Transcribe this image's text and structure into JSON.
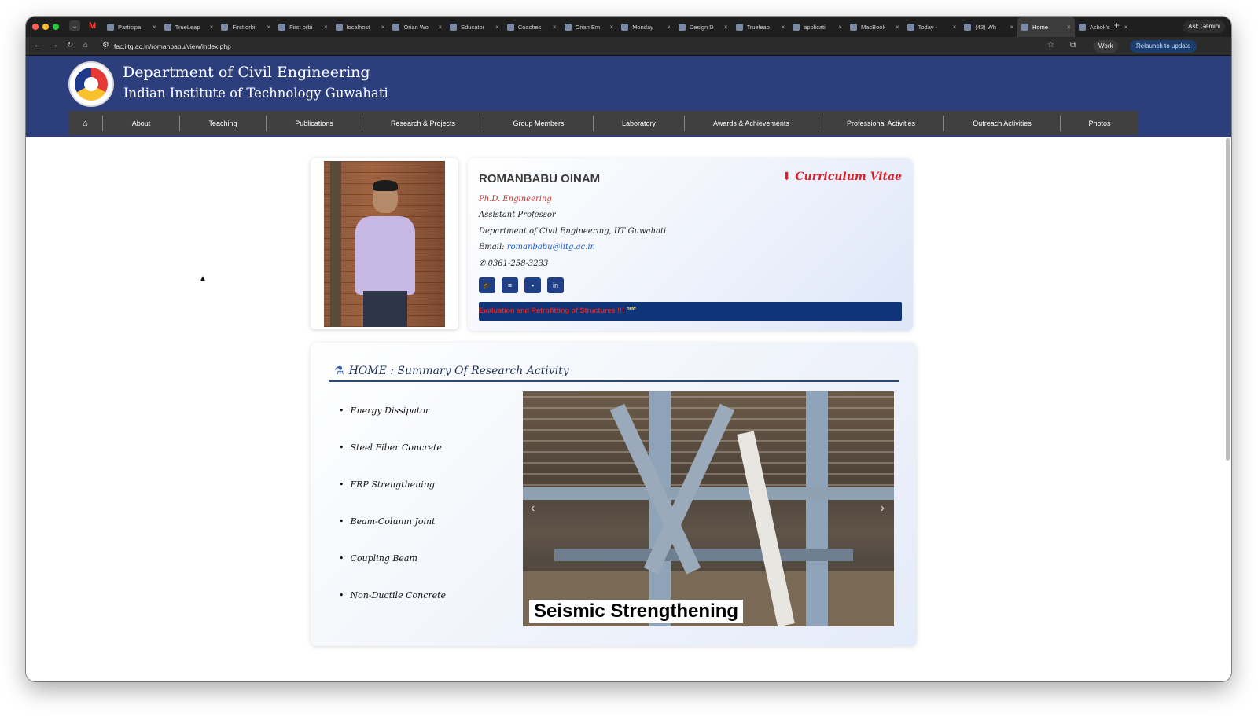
{
  "browser": {
    "tabs": [
      {
        "title": "Participa"
      },
      {
        "title": "TrueLeap"
      },
      {
        "title": "First orbi"
      },
      {
        "title": "First orbi"
      },
      {
        "title": "localhost"
      },
      {
        "title": "Orian Wo"
      },
      {
        "title": "Educator"
      },
      {
        "title": "Coaches"
      },
      {
        "title": "Orian Em"
      },
      {
        "title": "Monday"
      },
      {
        "title": "Design D"
      },
      {
        "title": "Trueleap"
      },
      {
        "title": "applicati"
      },
      {
        "title": "MacBook"
      },
      {
        "title": "Today -"
      },
      {
        "title": "(43) Wh"
      },
      {
        "title": "Home"
      },
      {
        "title": "Ashok's"
      }
    ],
    "active_tab_index": 16,
    "ask_gemini": "Ask Gemini",
    "url": "fac.iitg.ac.in/romanbabu/view/index.php",
    "profile": "Work",
    "relaunch": "Relaunch to update"
  },
  "header": {
    "department": "Department of Civil Engineering",
    "institute": "Indian Institute of Technology Guwahati"
  },
  "nav": {
    "home_icon": "home-icon",
    "items": [
      "About",
      "Teaching",
      "Publications",
      "Research & Projects",
      "Group Members",
      "Laboratory",
      "Awards & Achievements",
      "Professional Activities",
      "Outreach Activities",
      "Photos"
    ]
  },
  "profile": {
    "name": "ROMANBABU OINAM",
    "cv_label": "Curriculum Vitae",
    "degree": "Ph.D. Engineering",
    "position": "Assistant Professor",
    "department": "Department of Civil Engineering, IIT Guwahati",
    "email_label": "Email:",
    "email": "romanbabu@iitg.ac.in",
    "phone": "0361-258-3233",
    "ticker": "Evaluation and Retrofitting of Structures !!!",
    "ticker_badge": "new"
  },
  "summary": {
    "title": "HOME : Summary Of Research Activity",
    "topics": [
      "Energy Dissipator",
      "Steel Fiber Concrete",
      "FRP Strengthening",
      "Beam-Column Joint",
      "Coupling Beam",
      "Non-Ductile Concrete"
    ],
    "slide_caption": "Seismic Strengthening"
  },
  "colors": {
    "header_blue": "#2d3e7c",
    "menu_gray": "#404040",
    "cv_red": "#d61f2c",
    "ticker_blue": "#0f3578"
  }
}
